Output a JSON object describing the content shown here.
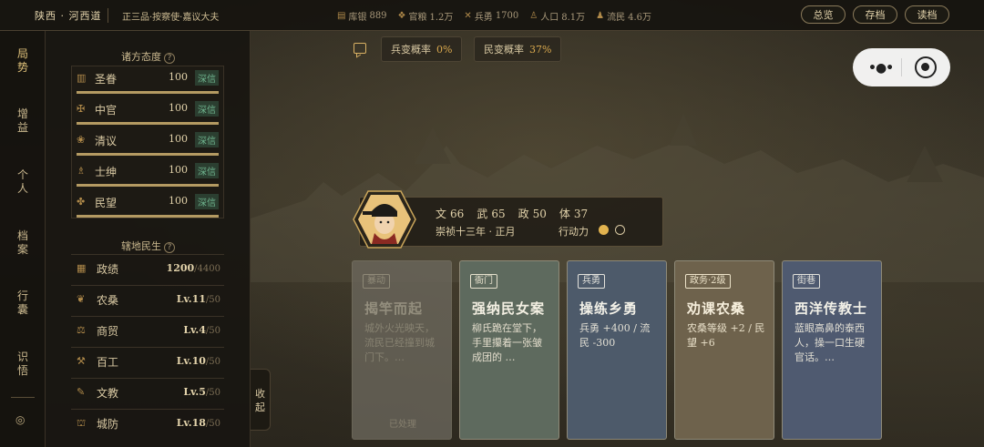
{
  "topbar": {
    "region": "陕西 · 河西道",
    "rank": "正三品·按察使·嘉议大夫",
    "stats": [
      {
        "icon": "treasury-icon",
        "label": "库银",
        "value": "889"
      },
      {
        "icon": "grain-icon",
        "label": "官粮",
        "value": "1.2万"
      },
      {
        "icon": "soldier-icon",
        "label": "兵勇",
        "value": "1700"
      },
      {
        "icon": "population-icon",
        "label": "人口",
        "value": "8.1万"
      },
      {
        "icon": "refugee-icon",
        "label": "流民",
        "value": "4.6万"
      }
    ],
    "buttons": [
      "总览",
      "存档",
      "读档"
    ]
  },
  "nav": {
    "items": [
      "局势",
      "增益",
      "个人",
      "档案",
      "行囊",
      "识悟"
    ],
    "gear_glyph": "◎"
  },
  "attitudes": {
    "title": "诸方态度",
    "help": "?",
    "rows": [
      {
        "icon": "edict-icon",
        "name": "圣眷",
        "value": "100",
        "badge": "深信",
        "fill": 1.0
      },
      {
        "icon": "eunuch-icon",
        "name": "中官",
        "value": "100",
        "badge": "深信",
        "fill": 1.0
      },
      {
        "icon": "scholar-icon",
        "name": "清议",
        "value": "100",
        "badge": "深信",
        "fill": 1.0
      },
      {
        "icon": "gentry-icon",
        "name": "士绅",
        "value": "100",
        "badge": "深信",
        "fill": 1.0
      },
      {
        "icon": "people-icon",
        "name": "民望",
        "value": "100",
        "badge": "深信",
        "fill": 1.0
      }
    ]
  },
  "jurisdiction": {
    "title": "辖地民生",
    "help": "?",
    "rows": [
      {
        "icon": "merit-icon",
        "name": "政绩",
        "value": "1200",
        "max": "/4400"
      },
      {
        "icon": "farm-icon",
        "name": "农桑",
        "value": "Lv.11",
        "max": "/50"
      },
      {
        "icon": "trade-icon",
        "name": "商贸",
        "value": "Lv.4",
        "max": "/50"
      },
      {
        "icon": "craft-icon",
        "name": "百工",
        "value": "Lv.10",
        "max": "/50"
      },
      {
        "icon": "education-icon",
        "name": "文教",
        "value": "Lv.5",
        "max": "/50"
      },
      {
        "icon": "wall-icon",
        "name": "城防",
        "value": "Lv.18",
        "max": "/50"
      }
    ]
  },
  "collapse_label": [
    "收",
    "起"
  ],
  "probabilities": [
    {
      "label": "兵变概率",
      "value": "0%"
    },
    {
      "label": "民变概率",
      "value": "37%"
    }
  ],
  "character": {
    "stats": [
      {
        "label": "文",
        "value": "66"
      },
      {
        "label": "武",
        "value": "65"
      },
      {
        "label": "政",
        "value": "50"
      },
      {
        "label": "体",
        "value": "37"
      }
    ],
    "date": "崇祯十三年 · 正月",
    "ap_label": "行动力",
    "ap_used": 1,
    "ap_total": 2
  },
  "events": [
    {
      "tag": "暴动",
      "title": "揭竿而起",
      "desc": "城外火光映天，流民已经撞到城门下。…",
      "status": "已处理",
      "faded": true,
      "colors": {
        "bg": "#6b675c",
        "tag": "#a29c8a",
        "title": "#a9a493",
        "desc": "#9c9785"
      }
    },
    {
      "tag": "衙门",
      "title": "强纳民女案",
      "desc": "柳氏跪在堂下，手里攥着一张皱成团的 …",
      "status": "",
      "faded": false,
      "colors": {
        "bg": "#5e6a5e",
        "tag": "#e5e0cc",
        "title": "#f3efe2",
        "desc": "#e2dccb"
      }
    },
    {
      "tag": "兵勇",
      "title": "操练乡勇",
      "desc": "兵勇 +400 / 流民 -300",
      "status": "",
      "faded": false,
      "colors": {
        "bg": "#4d5a6a",
        "tag": "#e3e2dc",
        "title": "#f3f1e8",
        "desc": "#e2dfd4"
      }
    },
    {
      "tag": "政务·2级",
      "title": "劝课农桑",
      "desc": "农桑等级 +2 / 民望 +6",
      "status": "",
      "faded": false,
      "colors": {
        "bg": "#6e624c",
        "tag": "#ece2c8",
        "title": "#f6eedb",
        "desc": "#e8dfc8"
      }
    },
    {
      "tag": "街巷",
      "title": "西洋传教士",
      "desc": "蓝眼高鼻的泰西人，操一口生硬官话。…",
      "status": "",
      "faded": false,
      "colors": {
        "bg": "#4f5a70",
        "tag": "#e3e2dc",
        "title": "#f3f1e8",
        "desc": "#e2dfd4"
      }
    }
  ]
}
